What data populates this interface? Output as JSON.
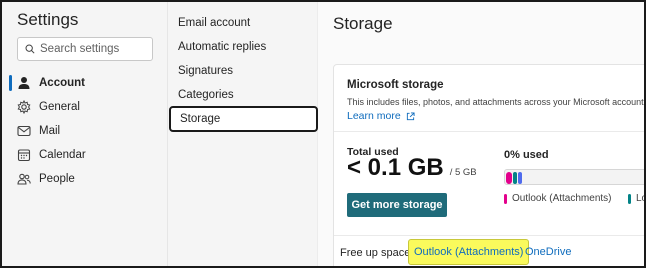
{
  "colors": {
    "accent": "#0f6cbd",
    "button": "#1f6b7a",
    "highlight": "#fafa5c",
    "outlook_attachments": "#e3008c",
    "other": "#4f6bed",
    "teal": "#038387"
  },
  "settings": {
    "title": "Settings",
    "search_placeholder": "Search settings"
  },
  "left_nav": {
    "items": [
      {
        "label": "Account",
        "icon": "person-icon"
      },
      {
        "label": "General",
        "icon": "gear-icon"
      },
      {
        "label": "Mail",
        "icon": "mail-icon"
      },
      {
        "label": "Calendar",
        "icon": "calendar-icon"
      },
      {
        "label": "People",
        "icon": "people-icon"
      }
    ],
    "selected_label": "Account"
  },
  "account_nav": {
    "items": [
      "Email account",
      "Automatic replies",
      "Signatures",
      "Categories",
      "Storage"
    ],
    "selected": "Storage"
  },
  "content": {
    "title": "Storage",
    "card": {
      "heading": "Microsoft storage",
      "description": "This includes files, photos, and attachments across your Microsoft account.",
      "learn_more": "Learn more",
      "total_label": "Total used",
      "total_value": "< 0.1 GB",
      "total_cap": "/ 5 GB",
      "percent_used_label": "0% used",
      "get_more_button": "Get more storage",
      "legend": [
        "Outlook (Attachments)",
        "Lo"
      ],
      "free_up_label": "Free up space",
      "free_up_links": [
        "Outlook (Attachments)",
        "OneDrive"
      ]
    }
  }
}
